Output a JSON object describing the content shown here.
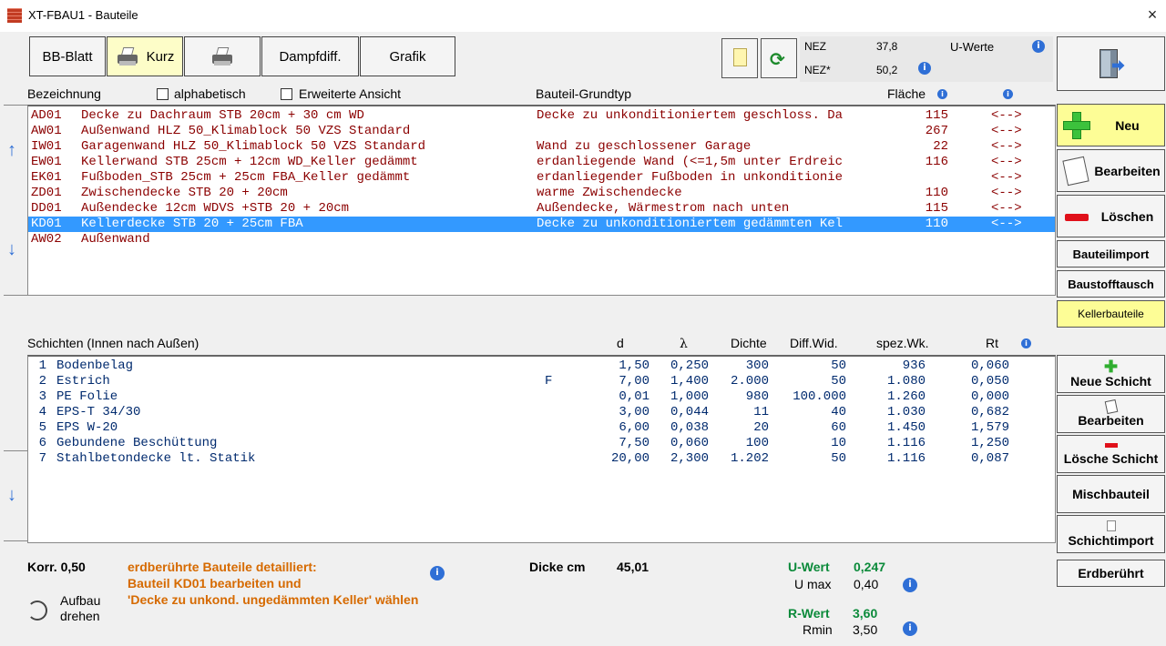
{
  "window": {
    "title": "XT-FBAU1 - Bauteile",
    "close": "×"
  },
  "toolbar": {
    "bb_blatt": "BB-Blatt",
    "kurz": "Kurz",
    "dampfdiff": "Dampfdiff.",
    "grafik": "Grafik"
  },
  "nez": {
    "nez_label": "NEZ",
    "nez_value": "37,8",
    "nez_star_label": "NEZ*",
    "nez_star_value": "50,2",
    "u_werte": "U-Werte"
  },
  "bauteile": {
    "header": {
      "bezeichnung": "Bezeichnung",
      "alphabetisch": "alphabetisch",
      "erweiterte": "Erweiterte Ansicht",
      "grundtyp": "Bauteil-Grundtyp",
      "flaeche": "Fläche"
    },
    "rows": [
      {
        "code": "AD01",
        "name": "Decke zu Dachraum STB 20cm + 30 cm WD",
        "typ": "Decke zu unkonditioniertem geschloss. Da",
        "flaeche": "115",
        "link": "<-->"
      },
      {
        "code": "AW01",
        "name": "Außenwand HLZ 50_Klimablock 50 VZS Standard",
        "typ": "",
        "flaeche": "267",
        "link": "<-->"
      },
      {
        "code": "IW01",
        "name": "Garagenwand HLZ 50_Klimablock 50 VZS Standard",
        "typ": "Wand zu geschlossener Garage",
        "flaeche": "22",
        "link": "<-->"
      },
      {
        "code": "EW01",
        "name": "Kellerwand STB 25cm + 12cm WD_Keller gedämmt",
        "typ": "erdanliegende Wand (<=1,5m unter Erdreic",
        "flaeche": "116",
        "link": "<-->"
      },
      {
        "code": "EK01",
        "name": "Fußboden_STB 25cm + 25cm FBA_Keller gedämmt",
        "typ": "erdanliegender Fußboden in unkonditionie",
        "flaeche": "",
        "link": "<-->"
      },
      {
        "code": "ZD01",
        "name": "Zwischendecke STB 20 + 20cm",
        "typ": "warme Zwischendecke",
        "flaeche": "110",
        "link": "<-->"
      },
      {
        "code": "DD01",
        "name": "Außendecke 12cm WDVS +STB 20 + 20cm",
        "typ": "Außendecke, Wärmestrom nach unten",
        "flaeche": "115",
        "link": "<-->"
      },
      {
        "code": "KD01",
        "name": "Kellerdecke STB 20 + 25cm FBA",
        "typ": "Decke zu unkonditioniertem gedämmten Kel",
        "flaeche": "110",
        "link": "<-->"
      },
      {
        "code": "AW02",
        "name": "Außenwand",
        "typ": "",
        "flaeche": "",
        "link": ""
      }
    ],
    "selected_index": 7
  },
  "right": {
    "neu": "Neu",
    "bearbeiten": "Bearbeiten",
    "loeschen": "Löschen",
    "bauteilimport": "Bauteilimport",
    "baustofftausch": "Baustofftausch",
    "kellerbauteile": "Kellerbauteile",
    "neue_schicht": "Neue Schicht",
    "bearbeiten2": "Bearbeiten",
    "loesche_schicht": "Lösche Schicht",
    "mischbauteil": "Mischbauteil",
    "schichtimport": "Schichtimport",
    "erdberuehrt": "Erdberührt"
  },
  "schichten": {
    "header": {
      "title": "Schichten (Innen nach Außen)",
      "d": "d",
      "lambda": "λ",
      "dichte": "Dichte",
      "diff": "Diff.Wid.",
      "spez": "spez.Wk.",
      "rt": "Rt"
    },
    "rows": [
      {
        "nr": "1",
        "name": "Bodenbelag",
        "flag": "",
        "d": "1,50",
        "lambda": "0,250",
        "dichte": "300",
        "diff": "50",
        "spez": "936",
        "rt": "0,060"
      },
      {
        "nr": "2",
        "name": "Estrich",
        "flag": "F",
        "d": "7,00",
        "lambda": "1,400",
        "dichte": "2.000",
        "diff": "50",
        "spez": "1.080",
        "rt": "0,050"
      },
      {
        "nr": "3",
        "name": "PE Folie",
        "flag": "",
        "d": "0,01",
        "lambda": "1,000",
        "dichte": "980",
        "diff": "100.000",
        "spez": "1.260",
        "rt": "0,000"
      },
      {
        "nr": "4",
        "name": "EPS-T 34/30",
        "flag": "",
        "d": "3,00",
        "lambda": "0,044",
        "dichte": "11",
        "diff": "40",
        "spez": "1.030",
        "rt": "0,682"
      },
      {
        "nr": "5",
        "name": "EPS W-20",
        "flag": "",
        "d": "6,00",
        "lambda": "0,038",
        "dichte": "20",
        "diff": "60",
        "spez": "1.450",
        "rt": "1,579"
      },
      {
        "nr": "6",
        "name": "Gebundene Beschüttung",
        "flag": "",
        "d": "7,50",
        "lambda": "0,060",
        "dichte": "100",
        "diff": "10",
        "spez": "1.116",
        "rt": "1,250"
      },
      {
        "nr": "7",
        "name": "Stahlbetondecke lt. Statik",
        "flag": "",
        "d": "20,00",
        "lambda": "2,300",
        "dichte": "1.202",
        "diff": "50",
        "spez": "1.116",
        "rt": "0,087"
      }
    ]
  },
  "footer": {
    "korr": "Korr. 0,50",
    "hint1": "erdberührte Bauteile detailliert:",
    "hint2": "Bauteil KD01 bearbeiten und",
    "hint3": "'Decke zu unkond. ungedämmten Keller' wählen",
    "aufbau1": "Aufbau",
    "aufbau2": "drehen",
    "dicke_label": "Dicke cm",
    "dicke_value": "45,01",
    "uwert_label": "U-Wert",
    "uwert_value": "0,247",
    "umax_label": "U max",
    "umax_value": "0,40",
    "rwert_label": "R-Wert",
    "rwert_value": "3,60",
    "rmin_label": "Rmin",
    "rmin_value": "3,50"
  },
  "icons": {
    "info": "i"
  }
}
